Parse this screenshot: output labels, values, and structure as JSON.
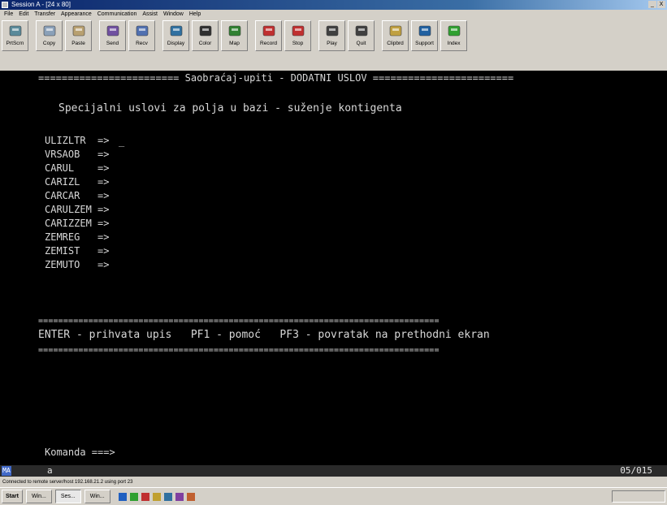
{
  "window": {
    "title": "Session A - [24 x 80]",
    "controls": [
      "_",
      "X"
    ]
  },
  "menu": [
    "File",
    "Edit",
    "Transfer",
    "Appearance",
    "Communication",
    "Assist",
    "Window",
    "Help"
  ],
  "toolbar": [
    {
      "label": "PrtScrn",
      "icon": "print-screen-icon",
      "color": "#5a8a9a"
    },
    {
      "label": "Copy",
      "icon": "copy-icon",
      "color": "#8aa0b8"
    },
    {
      "label": "Paste",
      "icon": "paste-icon",
      "color": "#b8a070"
    },
    {
      "label": "Send",
      "icon": "send-icon",
      "color": "#7050a0"
    },
    {
      "label": "Recv",
      "icon": "receive-icon",
      "color": "#5070b0"
    },
    {
      "label": "Display",
      "icon": "display-icon",
      "color": "#3070a0"
    },
    {
      "label": "Color",
      "icon": "color-icon",
      "color": "#303030"
    },
    {
      "label": "Map",
      "icon": "map-icon",
      "color": "#308030"
    },
    {
      "label": "Record",
      "icon": "record-icon",
      "color": "#c03030"
    },
    {
      "label": "Stop",
      "icon": "stop-icon",
      "color": "#c03030"
    },
    {
      "label": "Play",
      "icon": "play-icon",
      "color": "#404040"
    },
    {
      "label": "Quit",
      "icon": "quit-icon",
      "color": "#404040"
    },
    {
      "label": "Clipbrd",
      "icon": "clipboard-icon",
      "color": "#c0a040"
    },
    {
      "label": "Support",
      "icon": "support-globe-icon",
      "color": "#2060a0"
    },
    {
      "label": "Index",
      "icon": "index-icon",
      "color": "#30a030"
    }
  ],
  "screen": {
    "header": "======================== Saobraćaj-upiti - DODATNI USLOV ========================",
    "subtitle": "Specijalni uslovi za polja u bazi - suženje kontigenta",
    "fields": [
      "ULIZLTR  =>",
      "VRSAOB   =>",
      "CARUL    =>",
      "CARIZL   =>",
      "CARCAR   =>",
      "CARULZEM =>",
      "CARIZZEM =>",
      "ZEMREG   =>",
      "ZEMIST   =>",
      "ZEMUTO   =>"
    ],
    "separator": "================================================================================",
    "footer": "ENTER - prihvata upis   PF1 - pomoć   PF3 - povratak na prethodni ekran",
    "command": "Komanda ===>"
  },
  "oia": {
    "indicator": "MA",
    "keyboard": "a",
    "cursor_position": "05/015"
  },
  "statusbar": "Connected to remote server/host 192.168.21.2 using port 23",
  "taskbar": {
    "start": "Start",
    "tasks": [
      "Win...",
      "Ses...",
      "Win..."
    ]
  }
}
